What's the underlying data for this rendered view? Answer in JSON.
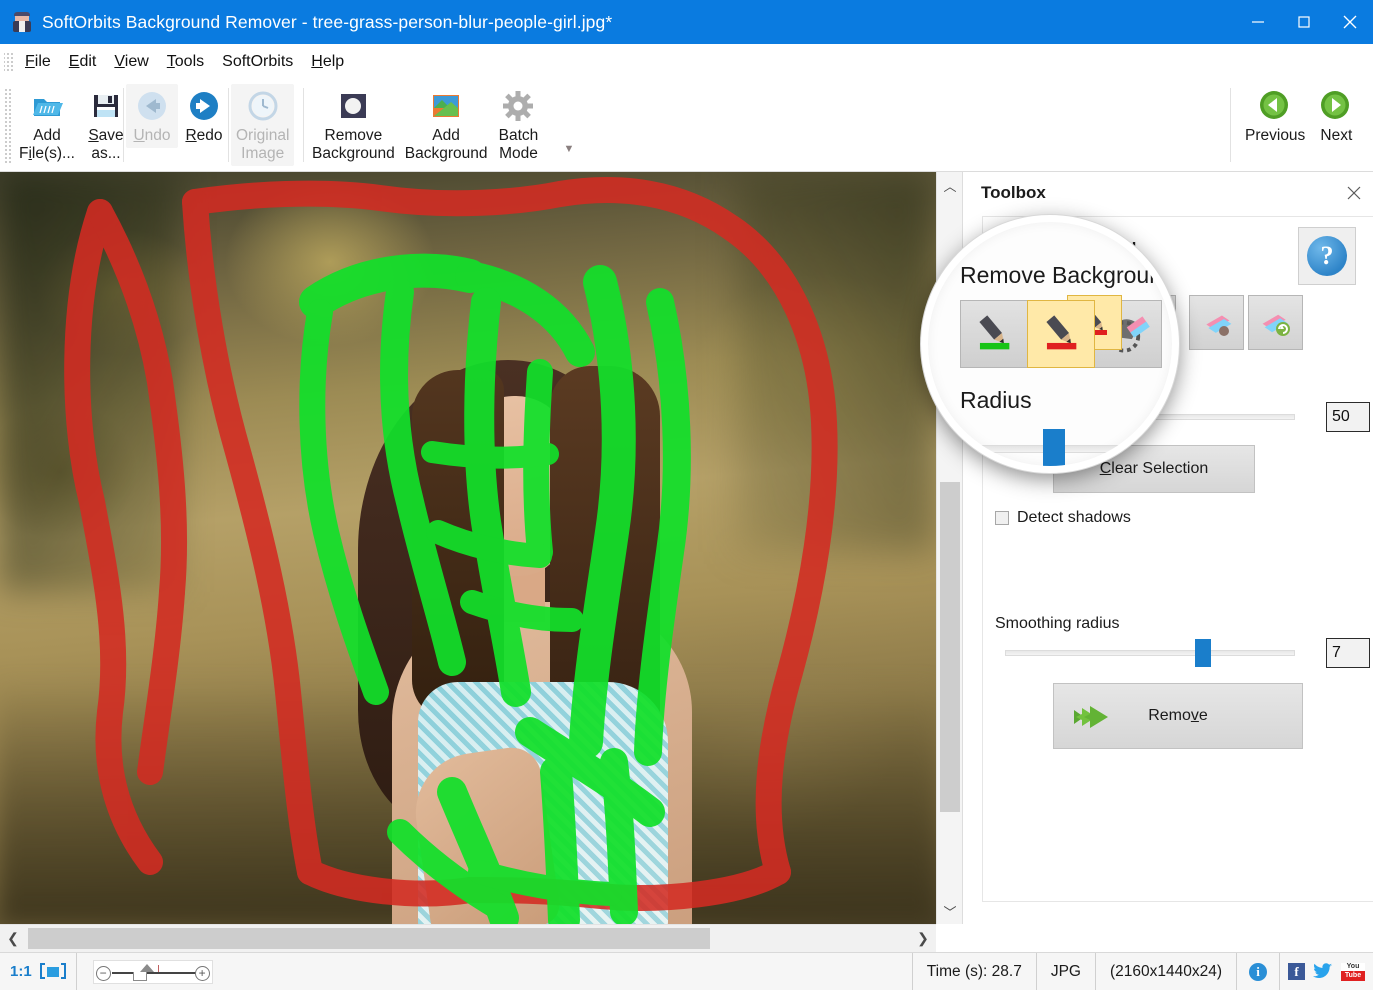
{
  "window": {
    "title": "SoftOrbits Background Remover - tree-grass-person-blur-people-girl.jpg*",
    "icon": "app-icon",
    "minimize": "minimize-icon",
    "maximize": "maximize-icon",
    "close": "close-icon",
    "titlebar_color": "#0a7be0"
  },
  "menu": {
    "items": [
      {
        "label": "File",
        "accel": "F"
      },
      {
        "label": "Edit",
        "accel": "E"
      },
      {
        "label": "View",
        "accel": "V"
      },
      {
        "label": "Tools",
        "accel": "T"
      },
      {
        "label": "SoftOrbits",
        "accel": ""
      },
      {
        "label": "Help",
        "accel": "H"
      }
    ]
  },
  "toolbar": {
    "buttons": [
      {
        "name": "add-files",
        "line1": "Add",
        "line2": "File(s)...",
        "icon": "open-folder-icon",
        "disabled": false
      },
      {
        "name": "save-as",
        "line1": "Save",
        "line2": "as...",
        "icon": "floppy-disk-icon",
        "disabled": false
      },
      {
        "name": "undo",
        "line1": "Undo",
        "line2": "",
        "icon": "undo-arrow-icon",
        "disabled": true
      },
      {
        "name": "redo",
        "line1": "Redo",
        "line2": "",
        "icon": "redo-arrow-icon",
        "disabled": false
      },
      {
        "name": "original-image",
        "line1": "Original",
        "line2": "Image",
        "icon": "clock-history-icon",
        "disabled": true
      },
      {
        "name": "remove-background",
        "line1": "Remove",
        "line2": "Background",
        "icon": "remove-bg-icon",
        "disabled": false
      },
      {
        "name": "add-background",
        "line1": "Add",
        "line2": "Background",
        "icon": "add-bg-icon",
        "disabled": false
      },
      {
        "name": "batch-mode",
        "line1": "Batch",
        "line2": "Mode",
        "icon": "gear-icon",
        "disabled": false
      }
    ],
    "nav": [
      {
        "name": "previous",
        "label": "Previous",
        "icon": "green-left-arrow-icon"
      },
      {
        "name": "next",
        "label": "Next",
        "icon": "green-right-arrow-icon"
      }
    ],
    "overflow": "toolbar-overflow-icon"
  },
  "toolbox": {
    "panel_title": "Toolbox",
    "close": "close-icon",
    "section_title_visible": "e Background",
    "help": "help-icon",
    "tools": [
      {
        "name": "green-marker-tool",
        "icon": "pencil-green-icon",
        "selected": false
      },
      {
        "name": "red-marker-tool",
        "icon": "pencil-red-icon",
        "selected": true
      },
      {
        "name": "smart-eraser-tool",
        "icon": "eraser-smart-icon",
        "selected": false
      }
    ],
    "tools_right": [
      {
        "name": "eraser-tool",
        "icon": "eraser-icon",
        "selected": false
      },
      {
        "name": "eraser-restore-tool",
        "icon": "eraser-restore-icon",
        "selected": false
      }
    ],
    "radius": {
      "label": "Radius",
      "value": "50",
      "slider_percent": 38
    },
    "clear_selection": {
      "label": "Clear Selection",
      "accel": "C"
    },
    "detect_shadows": {
      "label": "Detect shadows",
      "checked": false
    },
    "smoothing_radius": {
      "label": "Smoothing radius",
      "value": "7",
      "slider_percent": 68
    },
    "remove": {
      "label": "Remove",
      "accel": "v",
      "icon": "green-double-arrow-icon"
    }
  },
  "magnifier": {
    "title": "Remove Background",
    "radius_label": "Radius",
    "tools": [
      {
        "name": "green-marker-tool-zoomed",
        "icon": "pencil-green-icon",
        "selected": false
      },
      {
        "name": "red-marker-tool-zoomed",
        "icon": "pencil-red-icon",
        "selected": true
      },
      {
        "name": "smart-eraser-tool-zoomed",
        "icon": "eraser-smart-icon",
        "selected": false
      }
    ]
  },
  "canvas": {
    "image_description": "photo of a girl in a field with green keep-strokes and red remove-strokes",
    "keep_stroke_color": "#12e02a",
    "remove_stroke_color": "#d32b22",
    "vscroll": {
      "up": "chevron-up-icon",
      "down": "chevron-down-icon"
    },
    "hscroll": {
      "left": "chevron-left-icon",
      "right": "chevron-right-icon"
    }
  },
  "statusbar": {
    "zoom_ratio": "1:1",
    "fit_icon": "fit-to-window-icon",
    "zoom_out": "minus-icon",
    "zoom_in": "plus-icon",
    "time": "Time (s): 28.7",
    "format": "JPG",
    "dimensions": "(2160x1440x24)",
    "info": "info-icon",
    "facebook": "facebook-icon",
    "twitter": "twitter-icon",
    "youtube_top": "You",
    "youtube_bottom": "Tube"
  }
}
